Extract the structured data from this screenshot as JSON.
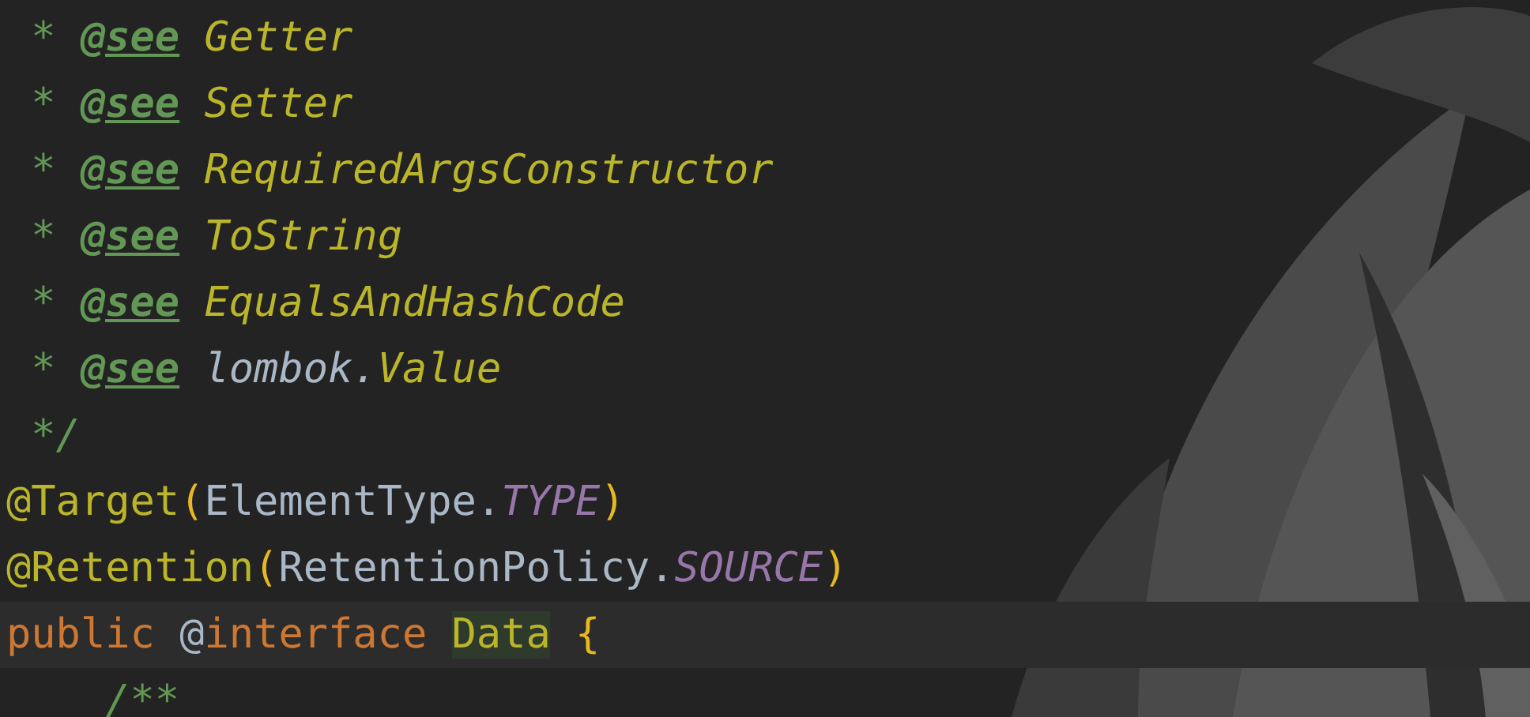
{
  "editor": {
    "lines": [
      {
        "current": false,
        "tokens": [
          {
            "text": " * ",
            "kind": "comment"
          },
          {
            "text": "@see",
            "kind": "doctag"
          },
          {
            "text": " Getter",
            "kind": "docref"
          }
        ]
      },
      {
        "current": false,
        "tokens": [
          {
            "text": " * ",
            "kind": "comment"
          },
          {
            "text": "@see",
            "kind": "doctag"
          },
          {
            "text": " Setter",
            "kind": "docref"
          }
        ]
      },
      {
        "current": false,
        "tokens": [
          {
            "text": " * ",
            "kind": "comment"
          },
          {
            "text": "@see",
            "kind": "doctag"
          },
          {
            "text": " RequiredArgsConstructor",
            "kind": "docref"
          }
        ]
      },
      {
        "current": false,
        "tokens": [
          {
            "text": " * ",
            "kind": "comment"
          },
          {
            "text": "@see",
            "kind": "doctag"
          },
          {
            "text": " ToString",
            "kind": "docref"
          }
        ]
      },
      {
        "current": false,
        "tokens": [
          {
            "text": " * ",
            "kind": "comment"
          },
          {
            "text": "@see",
            "kind": "doctag"
          },
          {
            "text": " EqualsAndHashCode",
            "kind": "docref"
          }
        ]
      },
      {
        "current": false,
        "tokens": [
          {
            "text": " * ",
            "kind": "comment"
          },
          {
            "text": "@see",
            "kind": "doctag"
          },
          {
            "text": " lombok.",
            "kind": "docpackage"
          },
          {
            "text": "Value",
            "kind": "docref"
          }
        ]
      },
      {
        "current": false,
        "tokens": [
          {
            "text": " */",
            "kind": "comment"
          }
        ]
      },
      {
        "current": false,
        "tokens": [
          {
            "text": "@Target",
            "kind": "annotation"
          },
          {
            "text": "(",
            "kind": "brace"
          },
          {
            "text": "ElementType.",
            "kind": "plain"
          },
          {
            "text": "TYPE",
            "kind": "constant"
          },
          {
            "text": ")",
            "kind": "brace"
          }
        ]
      },
      {
        "current": false,
        "tokens": [
          {
            "text": "@Retention",
            "kind": "annotation"
          },
          {
            "text": "(",
            "kind": "brace"
          },
          {
            "text": "RetentionPolicy.",
            "kind": "plain"
          },
          {
            "text": "SOURCE",
            "kind": "constant"
          },
          {
            "text": ")",
            "kind": "brace"
          }
        ]
      },
      {
        "current": true,
        "tokens": [
          {
            "text": "public ",
            "kind": "keyword"
          },
          {
            "text": "@",
            "kind": "plain"
          },
          {
            "text": "interface ",
            "kind": "keyword"
          },
          {
            "text": "Data",
            "kind": "highlighted"
          },
          {
            "text": " {",
            "kind": "brace"
          }
        ]
      },
      {
        "current": false,
        "tokens": [
          {
            "text": "    /**",
            "kind": "comment"
          }
        ]
      }
    ]
  }
}
